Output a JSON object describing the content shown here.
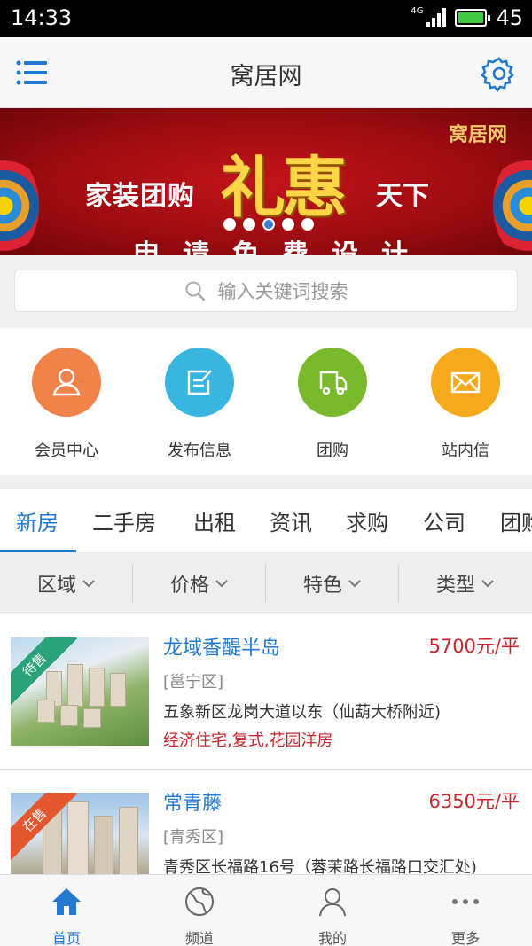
{
  "status_bar": {
    "time": "14:33",
    "network": "4G",
    "battery": "45"
  },
  "header": {
    "title": "窝居网",
    "menu_icon": "menu-list-icon",
    "settings_icon": "gear-icon"
  },
  "banner": {
    "brand": "窝居网",
    "headline": "家装团购",
    "big": "礼惠",
    "tail": "天下",
    "sub": "申请免费设计",
    "slides": 5,
    "active_slide": 3
  },
  "search": {
    "placeholder": "输入关键词搜索",
    "icon": "search-icon"
  },
  "quick_actions": [
    {
      "label": "会员中心",
      "icon": "user-icon",
      "color": "#f0834a"
    },
    {
      "label": "发布信息",
      "icon": "edit-icon",
      "color": "#38b6e0"
    },
    {
      "label": "团购",
      "icon": "truck-icon",
      "color": "#7ab92e"
    },
    {
      "label": "站内信",
      "icon": "mail-icon",
      "color": "#f5a91b"
    }
  ],
  "tabs": [
    "新房",
    "二手房",
    "出租",
    "资讯",
    "求购",
    "公司",
    "团购"
  ],
  "active_tab": "新房",
  "filters": [
    "区域",
    "价格",
    "特色",
    "类型"
  ],
  "listings": [
    {
      "name": "龙域香醍半岛",
      "price": "5700元/平",
      "district": "[邕宁区]",
      "address": "五象新区龙岗大道以东（仙葫大桥附近)",
      "tags": "经济住宅,复式,花园洋房",
      "status": "待售",
      "status_color": "#2aa37a"
    },
    {
      "name": "常青藤",
      "price": "6350元/平",
      "district": "[青秀区]",
      "address": "青秀区长福路16号（蓉茉路长福路口交汇处)",
      "tags": "",
      "status": "在售",
      "status_color": "#e4572e"
    }
  ],
  "bottom_nav": [
    {
      "label": "首页",
      "icon": "home-icon"
    },
    {
      "label": "频道",
      "icon": "globe-icon"
    },
    {
      "label": "我的",
      "icon": "person-icon"
    },
    {
      "label": "更多",
      "icon": "more-dots-icon"
    }
  ],
  "accent_color": "#2379d0",
  "price_color": "#c8262c"
}
